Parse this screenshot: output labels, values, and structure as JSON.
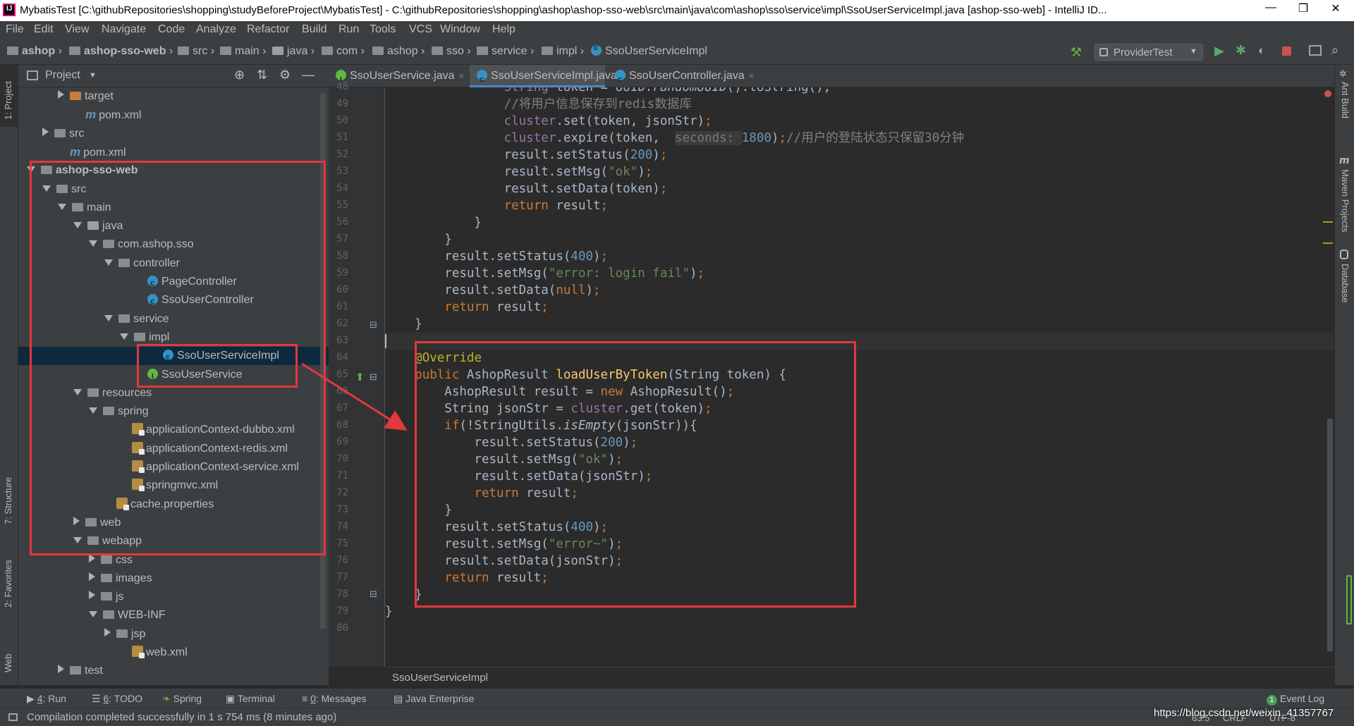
{
  "title_bar": {
    "app_logo": "IJ",
    "title": "MybatisTest [C:\\githubRepositories\\shopping\\studyBeforeProject\\MybatisTest] - C:\\githubRepositories\\shopping\\ashop\\ashop-sso-web\\src\\main\\java\\com\\ashop\\sso\\service\\impl\\SsoUserServiceImpl.java [ashop-sso-web] - IntelliJ ID...",
    "minimize": "—",
    "restore": "❐",
    "close": "✕"
  },
  "menu": [
    "File",
    "Edit",
    "View",
    "Navigate",
    "Code",
    "Analyze",
    "Refactor",
    "Build",
    "Run",
    "Tools",
    "VCS",
    "Window",
    "Help"
  ],
  "breadcrumbs": [
    "ashop",
    "ashop-sso-web",
    "src",
    "main",
    "java",
    "com",
    "ashop",
    "sso",
    "service",
    "impl",
    "SsoUserServiceImpl"
  ],
  "toolbar": {
    "run_config": "ProviderTest",
    "run_config_arrow": "▼"
  },
  "project_panel": {
    "title": "Project",
    "dropdown_arrow": "▼",
    "header_icons": [
      "target-icon",
      "collapse-icon",
      "gear-icon",
      "minimize-icon"
    ],
    "tree": [
      {
        "label": "target",
        "depth": 3,
        "icon": "folder-orange",
        "arrow": "r"
      },
      {
        "label": "pom.xml",
        "depth": 4,
        "icon": "maven",
        "arrow": ""
      },
      {
        "label": "src",
        "depth": 2,
        "icon": "folder",
        "arrow": "r"
      },
      {
        "label": "pom.xml",
        "depth": 3,
        "icon": "maven",
        "arrow": ""
      },
      {
        "label": "ashop-sso-web",
        "depth": 1,
        "icon": "module",
        "arrow": "d",
        "bold": true
      },
      {
        "label": "src",
        "depth": 2,
        "icon": "folder",
        "arrow": "d"
      },
      {
        "label": "main",
        "depth": 3,
        "icon": "folder",
        "arrow": "d"
      },
      {
        "label": "java",
        "depth": 4,
        "icon": "folder-src",
        "arrow": "d"
      },
      {
        "label": "com.ashop.sso",
        "depth": 5,
        "icon": "package",
        "arrow": "d"
      },
      {
        "label": "controller",
        "depth": 6,
        "icon": "package",
        "arrow": "d"
      },
      {
        "label": "PageController",
        "depth": 8,
        "icon": "class",
        "arrow": ""
      },
      {
        "label": "SsoUserController",
        "depth": 8,
        "icon": "class",
        "arrow": ""
      },
      {
        "label": "service",
        "depth": 6,
        "icon": "package",
        "arrow": "d"
      },
      {
        "label": "impl",
        "depth": 7,
        "icon": "package",
        "arrow": "d"
      },
      {
        "label": "SsoUserServiceImpl",
        "depth": 9,
        "icon": "class",
        "arrow": "",
        "selected": true
      },
      {
        "label": "SsoUserService",
        "depth": 8,
        "icon": "interface",
        "arrow": ""
      },
      {
        "label": "resources",
        "depth": 4,
        "icon": "folder-res",
        "arrow": "d"
      },
      {
        "label": "spring",
        "depth": 5,
        "icon": "folder",
        "arrow": "d"
      },
      {
        "label": "applicationContext-dubbo.xml",
        "depth": 7,
        "icon": "xml",
        "arrow": ""
      },
      {
        "label": "applicationContext-redis.xml",
        "depth": 7,
        "icon": "xml",
        "arrow": ""
      },
      {
        "label": "applicationContext-service.xml",
        "depth": 7,
        "icon": "xml",
        "arrow": ""
      },
      {
        "label": "springmvc.xml",
        "depth": 7,
        "icon": "xml",
        "arrow": ""
      },
      {
        "label": "cache.properties",
        "depth": 6,
        "icon": "props",
        "arrow": ""
      },
      {
        "label": "web",
        "depth": 4,
        "icon": "folder",
        "arrow": "r"
      },
      {
        "label": "webapp",
        "depth": 4,
        "icon": "folder",
        "arrow": "d"
      },
      {
        "label": "css",
        "depth": 5,
        "icon": "folder",
        "arrow": "r"
      },
      {
        "label": "images",
        "depth": 5,
        "icon": "folder",
        "arrow": "r"
      },
      {
        "label": "js",
        "depth": 5,
        "icon": "folder",
        "arrow": "r"
      },
      {
        "label": "WEB-INF",
        "depth": 5,
        "icon": "folder",
        "arrow": "d"
      },
      {
        "label": "jsp",
        "depth": 6,
        "icon": "folder",
        "arrow": "r"
      },
      {
        "label": "web.xml",
        "depth": 7,
        "icon": "xml",
        "arrow": ""
      },
      {
        "label": "test",
        "depth": 3,
        "icon": "folder",
        "arrow": "r"
      }
    ]
  },
  "tabs": [
    {
      "label": "SsoUserService.java",
      "icon": "interface",
      "close": "×",
      "active": false
    },
    {
      "label": "SsoUserServiceImpl.java",
      "icon": "class",
      "close": "×",
      "active": true
    },
    {
      "label": "SsoUserController.java",
      "icon": "class",
      "close": "×",
      "active": false
    }
  ],
  "editor": {
    "line_numbers": [
      "48",
      "49",
      "50",
      "51",
      "52",
      "53",
      "54",
      "55",
      "56",
      "57",
      "58",
      "59",
      "60",
      "61",
      "62",
      "63",
      "64",
      "65",
      "66",
      "67",
      "68",
      "69",
      "70",
      "71",
      "72",
      "73",
      "74",
      "75",
      "76",
      "77",
      "78",
      "79",
      "80"
    ],
    "breadcrumb": "SsoUserServiceImpl"
  },
  "left_strip": {
    "project": "1: Project",
    "structure": "7: Structure",
    "favorites": "2: Favorites",
    "web": "Web"
  },
  "right_strip": {
    "ant": "Ant Build",
    "maven": "Maven Projects",
    "database": "Database"
  },
  "bottom_tools": [
    {
      "key": "4",
      "label": ": Run"
    },
    {
      "key": "6",
      "label": ": TODO"
    },
    {
      "key": "",
      "label": "Spring"
    },
    {
      "key": "",
      "label": "Terminal"
    },
    {
      "key": "0",
      "label": ": Messages"
    },
    {
      "key": "",
      "label": "Java Enterprise"
    }
  ],
  "event_log": {
    "badge": "1",
    "label": "Event Log"
  },
  "status": {
    "message": "Compilation completed successfully in 1 s 754 ms (8 minutes ago)",
    "position": "63:5",
    "line_sep": "CRLF",
    "encoding": "UTF-8",
    "watermark": "https://blog.csdn.net/weixin_41357767"
  }
}
